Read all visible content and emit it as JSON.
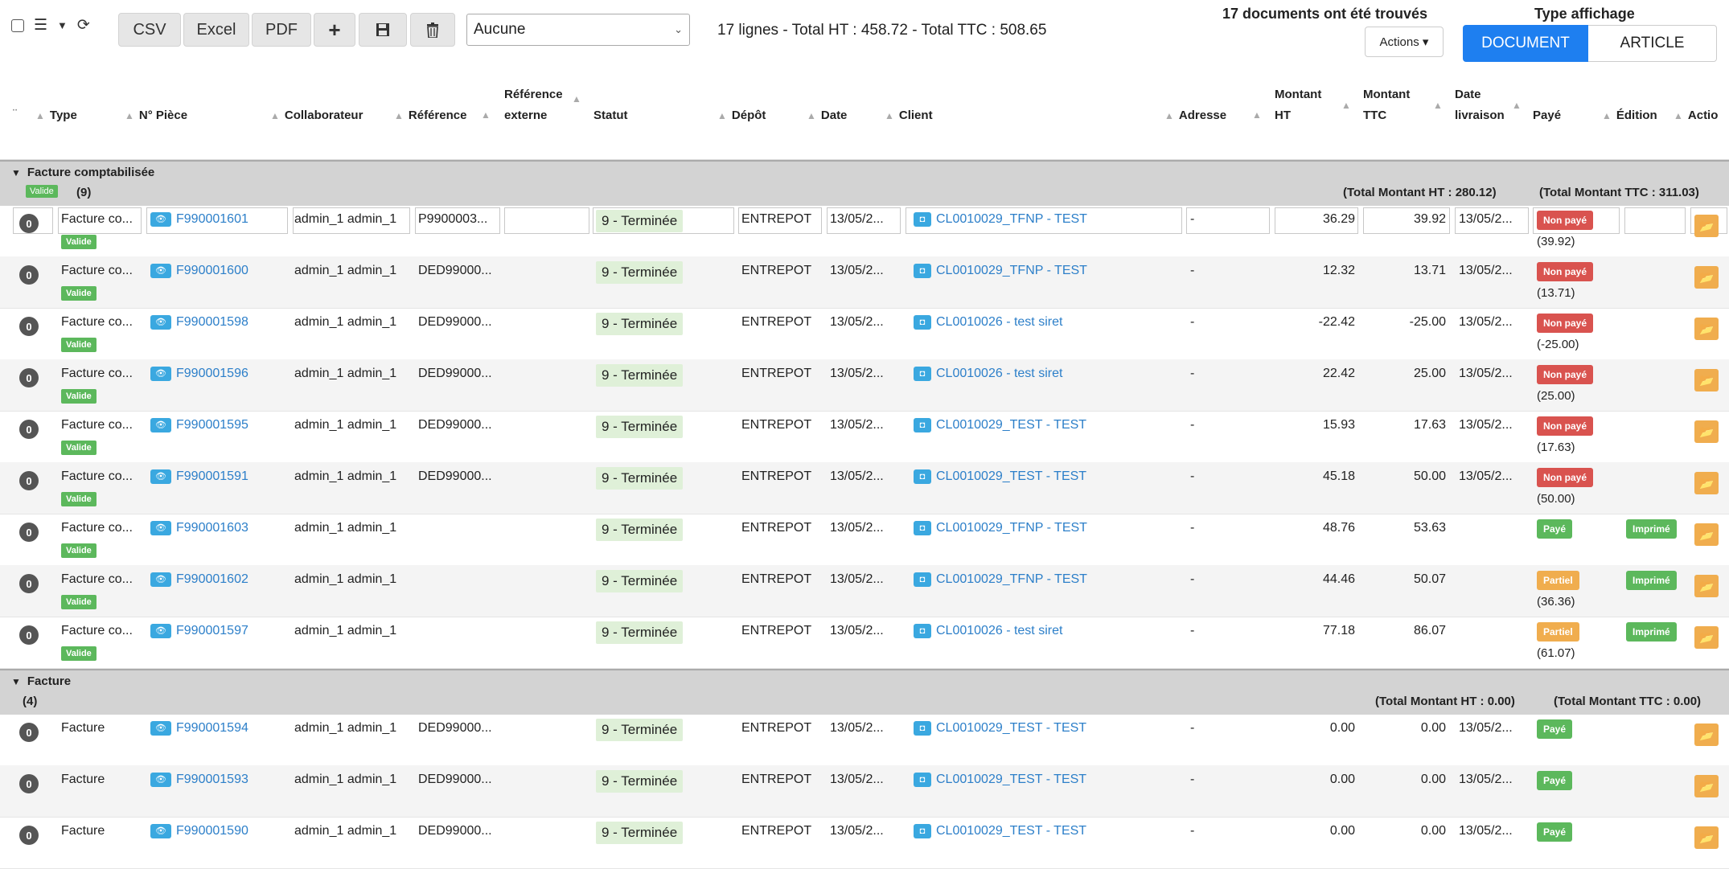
{
  "toolbar": {
    "csv": "CSV",
    "excel": "Excel",
    "pdf": "PDF",
    "select_value": "Aucune",
    "totals": "17 lignes - Total HT : 458.72 - Total TTC : 508.65",
    "found": "17 documents ont été trouvés",
    "type_affichage": "Type affichage",
    "actions": "Actions ▾",
    "document": "DOCUMENT",
    "article": "ARTICLE"
  },
  "header": {
    "type": "Type",
    "piece": "N° Pièce",
    "collab": "Collaborateur",
    "ref": "Référence",
    "ref_ext_1": "Référence",
    "ref_ext_2": "externe",
    "statut": "Statut",
    "depot": "Dépôt",
    "date": "Date",
    "client": "Client",
    "adresse": "Adresse",
    "mht_1": "Montant",
    "mht_2": "HT",
    "mttc_1": "Montant",
    "mttc_2": "TTC",
    "dliv_1": "Date",
    "dliv_2": "livraison",
    "paye": "Payé",
    "edition": "Édition",
    "actions": "Actio"
  },
  "groups": [
    {
      "title": "Facture comptabilisée",
      "badge": "Valide",
      "count": "(9)",
      "total_ht": "(Total Montant HT : 280.12)",
      "total_ttc": "(Total Montant TTC : 311.03)"
    },
    {
      "title": "Facture",
      "count": "(4)",
      "total_ht": "(Total Montant HT : 0.00)",
      "total_ttc": "(Total Montant TTC : 0.00)"
    }
  ],
  "rows": [
    {
      "type": "Facture co...",
      "piece": "F990001601",
      "collab": "admin_1 admin_1",
      "ref": "P9900003...",
      "statut": "9 - Terminée",
      "depot": "ENTREPOT",
      "date": "13/05/2...",
      "client": "CL0010029_TFNP - TEST",
      "adresse": "-",
      "ht": "36.29",
      "ttc": "39.92",
      "dliv": "13/05/2...",
      "paye": "Non payé",
      "paysub": "(39.92)",
      "edition": ""
    },
    {
      "type": "Facture co...",
      "piece": "F990001600",
      "collab": "admin_1 admin_1",
      "ref": "DED99000...",
      "statut": "9 - Terminée",
      "depot": "ENTREPOT",
      "date": "13/05/2...",
      "client": "CL0010029_TFNP - TEST",
      "adresse": "-",
      "ht": "12.32",
      "ttc": "13.71",
      "dliv": "13/05/2...",
      "paye": "Non payé",
      "paysub": "(13.71)",
      "edition": ""
    },
    {
      "type": "Facture co...",
      "piece": "F990001598",
      "collab": "admin_1 admin_1",
      "ref": "DED99000...",
      "statut": "9 - Terminée",
      "depot": "ENTREPOT",
      "date": "13/05/2...",
      "client": "CL0010026 - test siret",
      "adresse": "-",
      "ht": "-22.42",
      "ttc": "-25.00",
      "dliv": "13/05/2...",
      "paye": "Non payé",
      "paysub": "(-25.00)",
      "edition": ""
    },
    {
      "type": "Facture co...",
      "piece": "F990001596",
      "collab": "admin_1 admin_1",
      "ref": "DED99000...",
      "statut": "9 - Terminée",
      "depot": "ENTREPOT",
      "date": "13/05/2...",
      "client": "CL0010026 - test siret",
      "adresse": "-",
      "ht": "22.42",
      "ttc": "25.00",
      "dliv": "13/05/2...",
      "paye": "Non payé",
      "paysub": "(25.00)",
      "edition": ""
    },
    {
      "type": "Facture co...",
      "piece": "F990001595",
      "collab": "admin_1 admin_1",
      "ref": "DED99000...",
      "statut": "9 - Terminée",
      "depot": "ENTREPOT",
      "date": "13/05/2...",
      "client": "CL0010029_TEST - TEST",
      "adresse": "-",
      "ht": "15.93",
      "ttc": "17.63",
      "dliv": "13/05/2...",
      "paye": "Non payé",
      "paysub": "(17.63)",
      "edition": ""
    },
    {
      "type": "Facture co...",
      "piece": "F990001591",
      "collab": "admin_1 admin_1",
      "ref": "DED99000...",
      "statut": "9 - Terminée",
      "depot": "ENTREPOT",
      "date": "13/05/2...",
      "client": "CL0010029_TEST - TEST",
      "adresse": "-",
      "ht": "45.18",
      "ttc": "50.00",
      "dliv": "13/05/2...",
      "paye": "Non payé",
      "paysub": "(50.00)",
      "edition": ""
    },
    {
      "type": "Facture co...",
      "piece": "F990001603",
      "collab": "admin_1 admin_1",
      "ref": "",
      "statut": "9 - Terminée",
      "depot": "ENTREPOT",
      "date": "13/05/2...",
      "client": "CL0010029_TFNP - TEST",
      "adresse": "-",
      "ht": "48.76",
      "ttc": "53.63",
      "dliv": "",
      "paye": "Payé",
      "paysub": "",
      "edition": "Imprimé"
    },
    {
      "type": "Facture co...",
      "piece": "F990001602",
      "collab": "admin_1 admin_1",
      "ref": "",
      "statut": "9 - Terminée",
      "depot": "ENTREPOT",
      "date": "13/05/2...",
      "client": "CL0010029_TFNP - TEST",
      "adresse": "-",
      "ht": "44.46",
      "ttc": "50.07",
      "dliv": "",
      "paye": "Partiel",
      "paysub": "(36.36)",
      "edition": "Imprimé"
    },
    {
      "type": "Facture co...",
      "piece": "F990001597",
      "collab": "admin_1 admin_1",
      "ref": "",
      "statut": "9 - Terminée",
      "depot": "ENTREPOT",
      "date": "13/05/2...",
      "client": "CL0010026 - test siret",
      "adresse": "-",
      "ht": "77.18",
      "ttc": "86.07",
      "dliv": "",
      "paye": "Partiel",
      "paysub": "(61.07)",
      "edition": "Imprimé"
    },
    {
      "type": "Facture",
      "piece": "F990001594",
      "collab": "admin_1 admin_1",
      "ref": "DED99000...",
      "statut": "9 - Terminée",
      "depot": "ENTREPOT",
      "date": "13/05/2...",
      "client": "CL0010029_TEST - TEST",
      "adresse": "-",
      "ht": "0.00",
      "ttc": "0.00",
      "dliv": "13/05/2...",
      "paye": "Payé",
      "paysub": "",
      "edition": ""
    },
    {
      "type": "Facture",
      "piece": "F990001593",
      "collab": "admin_1 admin_1",
      "ref": "DED99000...",
      "statut": "9 - Terminée",
      "depot": "ENTREPOT",
      "date": "13/05/2...",
      "client": "CL0010029_TEST - TEST",
      "adresse": "-",
      "ht": "0.00",
      "ttc": "0.00",
      "dliv": "13/05/2...",
      "paye": "Payé",
      "paysub": "",
      "edition": ""
    },
    {
      "type": "Facture",
      "piece": "F990001590",
      "collab": "admin_1 admin_1",
      "ref": "DED99000...",
      "statut": "9 - Terminée",
      "depot": "ENTREPOT",
      "date": "13/05/2...",
      "client": "CL0010029_TEST - TEST",
      "adresse": "-",
      "ht": "0.00",
      "ttc": "0.00",
      "dliv": "13/05/2...",
      "paye": "Payé",
      "paysub": "",
      "edition": ""
    }
  ],
  "row_badge": "Valide",
  "row_count_icon": "0",
  "colors": {
    "primary": "#1e7ff0",
    "link": "#2c7fc9",
    "danger": "#d9534f",
    "success": "#5cb85c",
    "warning": "#f0ad4e",
    "statut_bg": "#dff0d8",
    "group_bg": "#d3d3d3"
  }
}
